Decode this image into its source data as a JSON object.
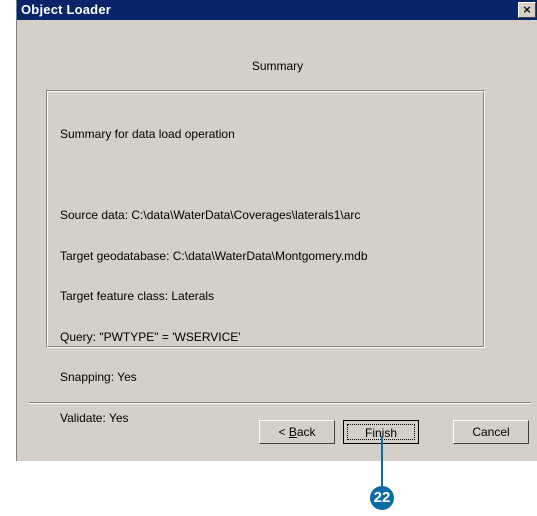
{
  "window": {
    "title": "Object Loader",
    "close_glyph": "×"
  },
  "page": {
    "heading": "Summary"
  },
  "summary": {
    "lines": [
      "Summary for data load operation",
      "",
      "Source data: C:\\data\\WaterData\\Coverages\\laterals1\\arc",
      "Target geodatabase: C:\\data\\WaterData\\Montgomery.mdb",
      "Target feature class: Laterals",
      "Query: \"PWTYPE\" = 'WSERVICE'",
      "Snapping: Yes",
      "Validate: Yes"
    ]
  },
  "buttons": {
    "back_prefix": "< ",
    "back_mnemonic": "B",
    "back_rest": "ack",
    "finish": "Finish",
    "cancel": "Cancel"
  },
  "callout": {
    "number": "22",
    "color": "#0b6da6"
  }
}
